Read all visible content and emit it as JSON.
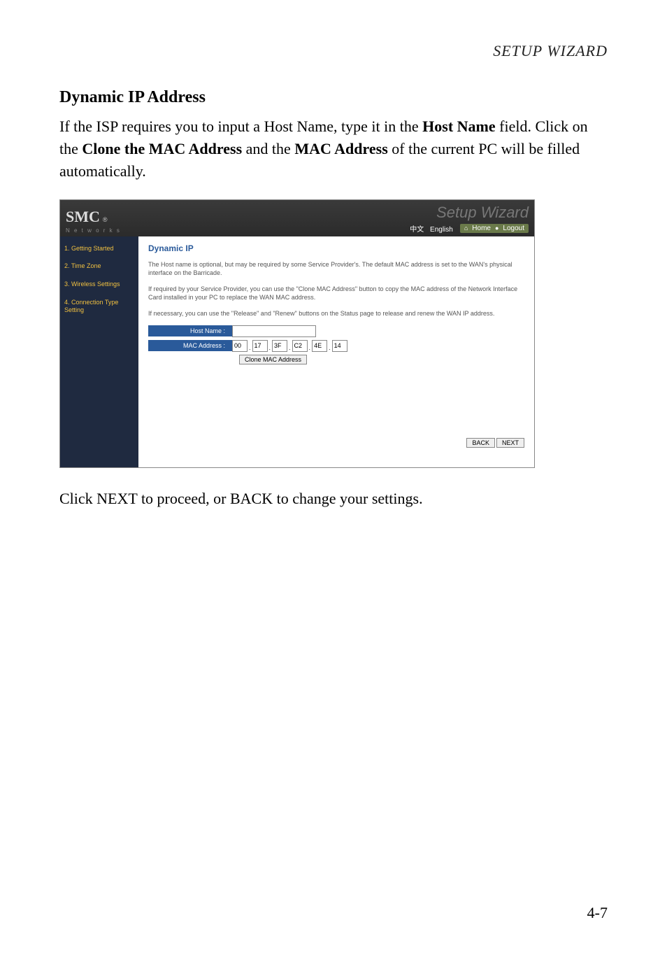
{
  "running_head": "SETUP WIZARD",
  "section_title": "Dynamic IP Address",
  "intro": {
    "t1": "If the ISP requires you to input a Host Name, type it in the ",
    "b1": "Host Name",
    "t2": " field. Click on the ",
    "b2": "Clone the MAC Address",
    "t3": " and the ",
    "b3": "MAC Address",
    "t4": " of the current PC will be filled automatically."
  },
  "screenshot": {
    "logo_main": "SMC",
    "logo_reg": "®",
    "logo_sub": "N e t w o r k s",
    "wizard_title": "Setup Wizard",
    "lang_zh": "中文",
    "lang_en": "English",
    "home_label": "Home",
    "logout_label": "Logout",
    "sidebar": {
      "s1": "1. Getting Started",
      "s2": "2. Time Zone",
      "s3": "3. Wireless Settings",
      "s4": "4. Connection Type Setting"
    },
    "content": {
      "title": "Dynamic IP",
      "p1": "The Host name is optional, but may be required by some Service Provider's. The default MAC address is set to the WAN's physical interface on the Barricade.",
      "p2": "If required by your Service Provider, you can use the \"Clone MAC Address\" button to copy the MAC address of the Network Interface Card installed in your PC to replace the WAN MAC address.",
      "p3": "If necessary, you can use the \"Release\" and \"Renew\" buttons on the Status page to release and renew the WAN IP address.",
      "host_label": "Host Name :",
      "mac_label": "MAC Address :",
      "mac": [
        "00",
        "17",
        "3F",
        "C2",
        "4E",
        "14"
      ],
      "clone_btn": "Clone MAC Address",
      "back": "BACK",
      "next": "NEXT"
    }
  },
  "closing": {
    "t1": "Click ",
    "b1": "NEXT",
    "t2": " to proceed, or ",
    "b2": "BACK",
    "t3": " to change your settings."
  },
  "page_number": "4-7"
}
